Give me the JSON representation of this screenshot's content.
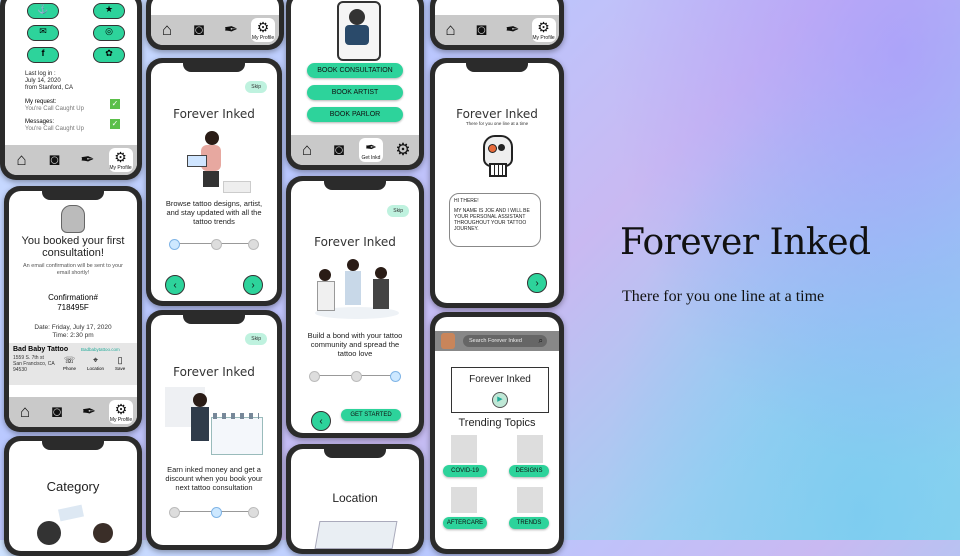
{
  "headline": {
    "title": "Forever Inked",
    "tagline": "There for you one line at a time"
  },
  "nav": {
    "home_icon": "home-icon",
    "camera_icon": "camera-icon",
    "tattoo_icon": "tattoo-gun-icon",
    "profile_icon": "gear-icon",
    "profile_label": "My Profile",
    "getinked_label": "Get Inkd"
  },
  "profile": {
    "last_login_label": "Last log in :",
    "last_login_date": "July 14, 2020",
    "last_login_place": "from Stanford, CA",
    "request_label": "My request:",
    "request_value": "You're Call Caught Up",
    "messages_label": "Messages:",
    "messages_value": "You're Call Caught Up"
  },
  "booked": {
    "title": "You booked your first consultation!",
    "email_note": "An email confirmation will be sent to your email shortly!",
    "confirmation_label": "Confirmation#",
    "confirmation_number": "718495F",
    "date": "Date: Friday, July 17, 2020",
    "time": "Time: 2:30 pm",
    "shop_name": "Bad Baby Tattoo",
    "shop_site": "Badbabytattoo.com",
    "shop_address1": "1559 S. 7th st",
    "shop_address2": "San Francisco, CA",
    "shop_zip": "94530",
    "action_phone": "Phone",
    "action_location": "Location",
    "action_save": "Save"
  },
  "category": {
    "title": "Category"
  },
  "onboard1": {
    "app_title": "Forever Inked",
    "skip": "Skip",
    "text": "Browse tattoo designs, artist, and stay updated with all the tattoo trends"
  },
  "onboard2": {
    "app_title": "Forever Inked",
    "skip": "Skip",
    "text": "Earn inked money and get a discount when you book your next tattoo consultation"
  },
  "booking": {
    "btn1": "BOOK CONSULTATION",
    "btn2": "BOOK ARTIST",
    "btn3": "BOOK PARLOR"
  },
  "onboard3": {
    "app_title": "Forever Inked",
    "skip": "Skip",
    "text": "Build a bond with your tattoo community and spread the tattoo love",
    "cta": "GET STARTED"
  },
  "location": {
    "title": "Location"
  },
  "assistant": {
    "app_title": "Forever Inked",
    "tagline": "There for you one line at a time",
    "greeting": "HI THERE!",
    "message": "MY NAME IS JOE AND I WILL BE YOUR PERSONAL ASSISTANT THROUGHOUT YOUR TATTOO JOURNEY."
  },
  "home": {
    "search_placeholder": "Search Forever Inked",
    "banner_title": "Forever Inked",
    "trending_title": "Trending Topics",
    "topics": [
      "COVID-19",
      "DESIGNS",
      "AFTERCARE",
      "TRENDS"
    ]
  },
  "colors": {
    "accent": "#2dd39b",
    "frame": "#2b2b2b",
    "navbar": "#c9c9c9"
  }
}
